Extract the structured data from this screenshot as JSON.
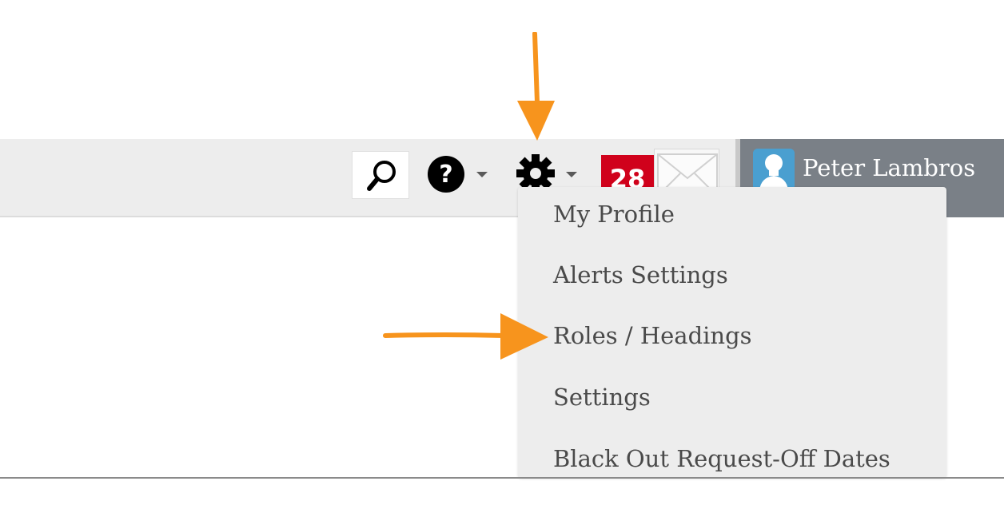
{
  "header": {
    "notification_count": "28",
    "user_name": "Peter Lambros"
  },
  "icons": {
    "search": "magnifier-icon",
    "help": "question-circle-icon",
    "settings": "gear-icon",
    "mail": "envelope-icon",
    "avatar": "user-silhouette-icon"
  },
  "settings_menu": {
    "items": [
      {
        "label": "My Profile"
      },
      {
        "label": "Alerts Settings"
      },
      {
        "label": "Roles / Headings"
      },
      {
        "label": "Settings"
      },
      {
        "label": "Black Out Request-Off Dates"
      }
    ]
  },
  "colors": {
    "annotation_arrow": "#f7941d",
    "badge": "#d0011b",
    "user_panel": "#7a8087",
    "toolbar": "#ededed"
  }
}
